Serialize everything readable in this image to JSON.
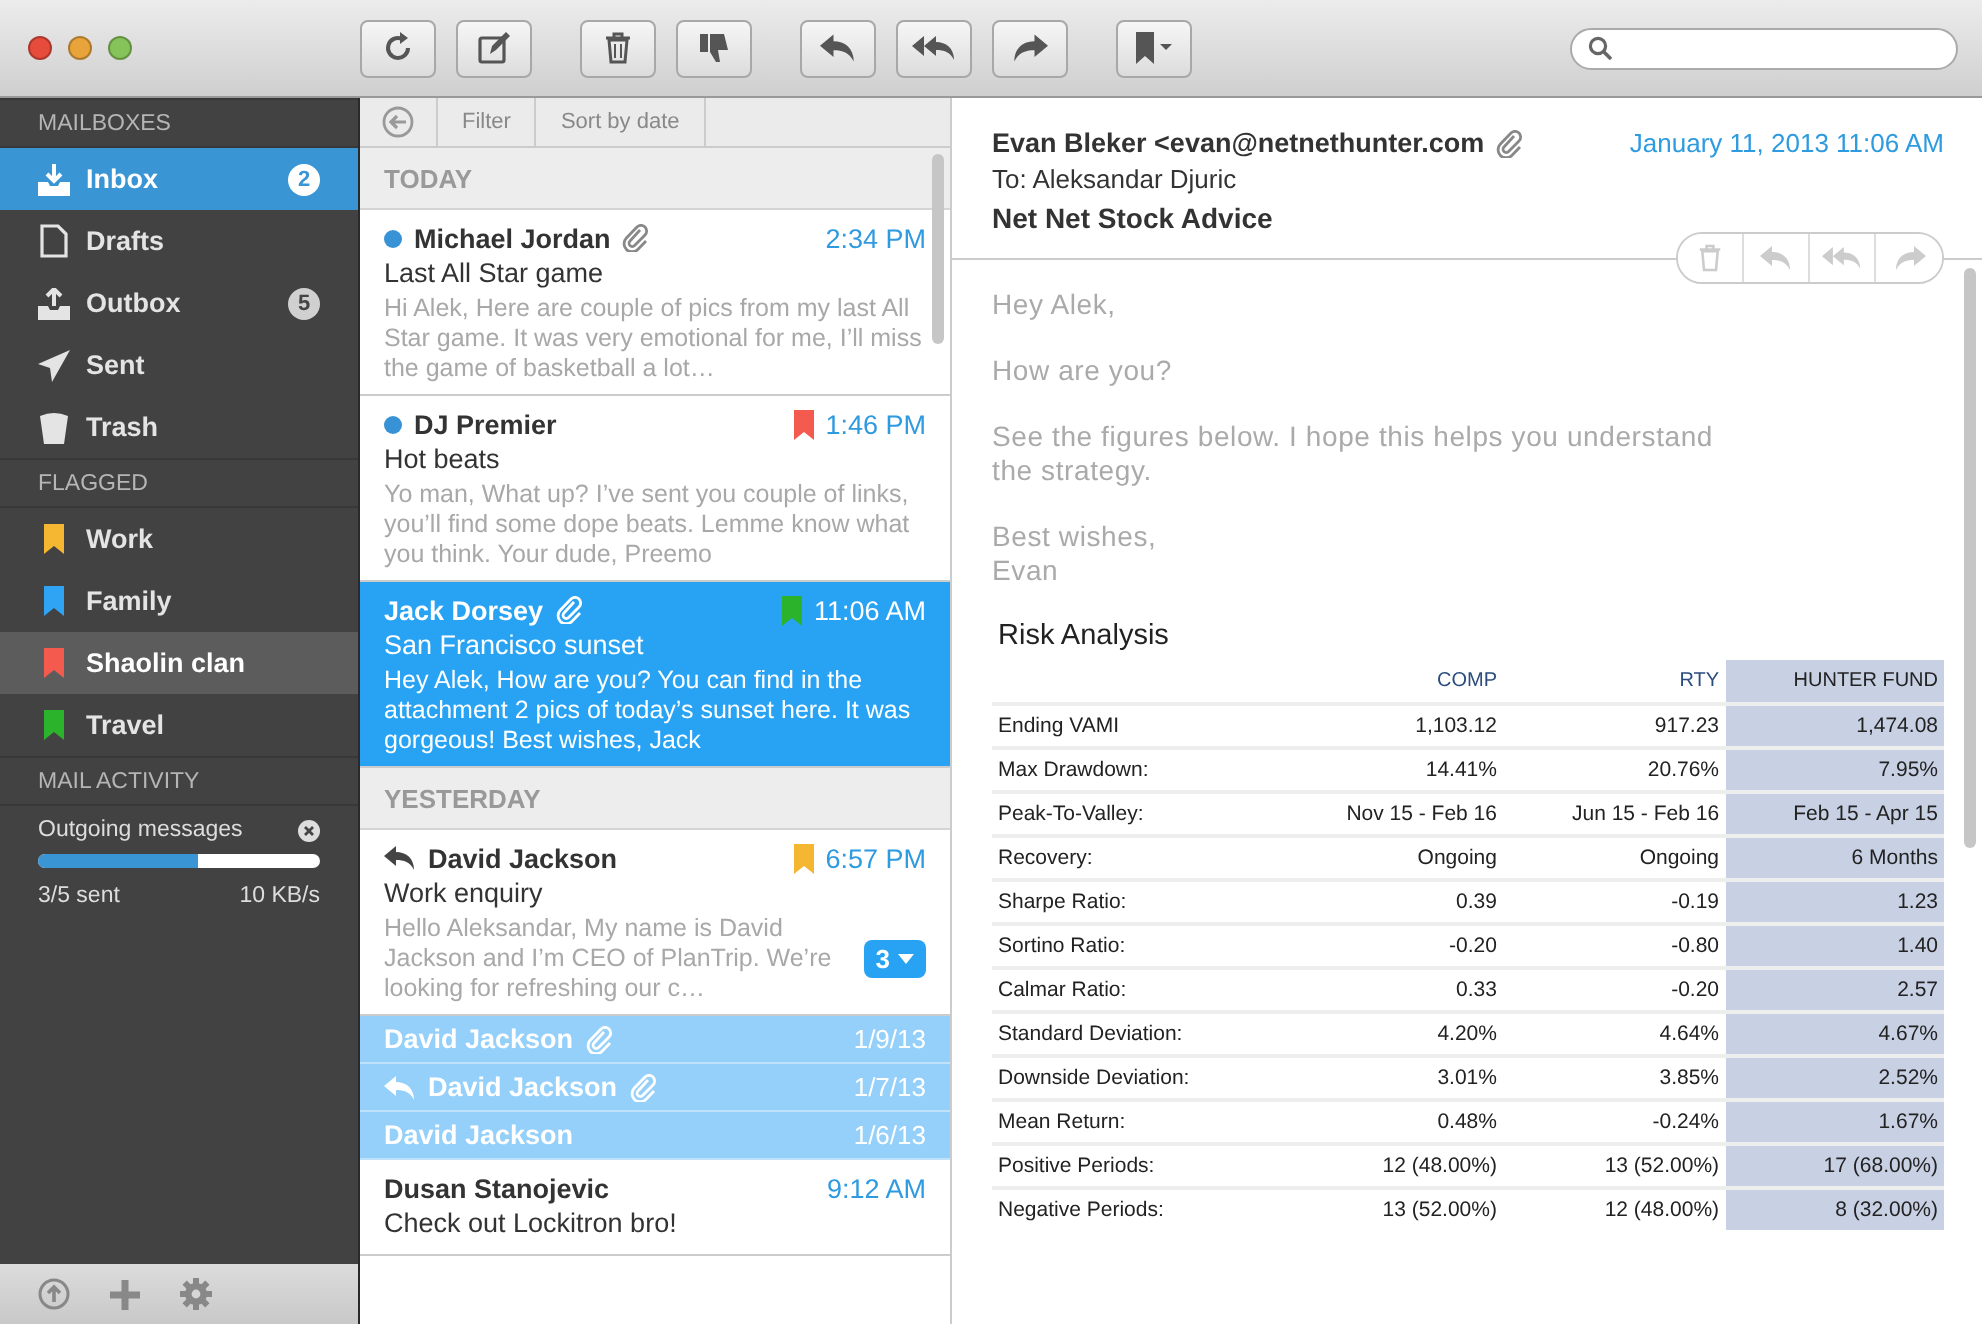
{
  "sidebar": {
    "sections": [
      {
        "title": "MAILBOXES",
        "kind": "mailboxes",
        "items": [
          {
            "label": "Inbox",
            "kind": "inbox",
            "badge": "2",
            "selected": true
          },
          {
            "label": "Drafts",
            "kind": "drafts",
            "selected": false
          },
          {
            "label": "Outbox",
            "kind": "outbox",
            "badge": "5",
            "selected": false
          },
          {
            "label": "Sent",
            "kind": "sent",
            "selected": false
          },
          {
            "label": "Trash",
            "kind": "trash",
            "selected": false
          }
        ]
      },
      {
        "title": "FLAGGED",
        "kind": "flags",
        "items": [
          {
            "label": "Work",
            "color": "#f5b731",
            "selected": false
          },
          {
            "label": "Family",
            "color": "#2fa4f5",
            "selected": false
          },
          {
            "label": "Shaolin clan",
            "color": "#f55a4e",
            "selected": true
          },
          {
            "label": "Travel",
            "color": "#2bb32b",
            "selected": false
          }
        ]
      },
      {
        "title": "MAIL ACTIVITY",
        "kind": "activity",
        "activity": {
          "label": "Outgoing messages",
          "level": 0.57,
          "count": "3/5 sent",
          "speed": "10 KB/s"
        }
      }
    ]
  },
  "message_list": {
    "filter": "Filter",
    "sort": "Sort by date",
    "groups": [
      {
        "title": "TODAY",
        "messages": [
          {
            "kind": "full",
            "sender": "Michael Jordan",
            "unread": true,
            "replied": false,
            "attachment": true,
            "time": "2:34 PM",
            "subject": "Last All Star game",
            "preview": "Hi Alek, Here are couple of pics from my last All Star game. It was very emotional for me, I’ll miss the game of basketball a lot…",
            "selected": false
          },
          {
            "kind": "full",
            "sender": "DJ Premier",
            "unread": true,
            "replied": false,
            "attachment": false,
            "color": "#f55a4e",
            "time": "1:46 PM",
            "subject": "Hot beats",
            "preview": "Yo man, What up? I’ve sent you couple of links, you’ll find some dope beats. Lemme know what you think. Your dude, Preemo",
            "selected": false
          },
          {
            "kind": "full",
            "sender": "Jack Dorsey",
            "unread": false,
            "replied": false,
            "attachment": true,
            "color": "#2bb32b",
            "time": "11:06 AM",
            "subject": "San Francisco sunset",
            "preview": "Hey Alek, How are you? You can find in the attachment 2 pics of today’s sunset here. It was gorgeous! Best wishes, Jack",
            "selected": true
          }
        ]
      },
      {
        "title": "YESTERDAY",
        "messages": [
          {
            "kind": "full",
            "sender": "David Jackson",
            "unread": false,
            "replied": true,
            "attachment": false,
            "color": "#f5b731",
            "time": "6:57 PM",
            "subject": "Work enquiry",
            "preview": "Hello Aleksandar, My name is David Jackson and I’m CEO of PlanTrip. We’re looking for refreshing our c…",
            "thread_count": "3",
            "selected": false
          },
          {
            "kind": "collapsed",
            "sender": "David Jackson",
            "replied": false,
            "attachment": true,
            "time": "1/9/13"
          },
          {
            "kind": "collapsed",
            "sender": "David Jackson",
            "replied": true,
            "attachment": true,
            "time": "1/7/13"
          },
          {
            "kind": "collapsed",
            "sender": "David Jackson",
            "replied": false,
            "attachment": false,
            "time": "1/6/13"
          },
          {
            "kind": "full",
            "sender": "Dusan Stanojevic",
            "unread": false,
            "replied": false,
            "attachment": false,
            "time": "9:12 AM",
            "subject": "Check out Lockitron bro!",
            "selected": false
          }
        ]
      }
    ]
  },
  "message": {
    "from": "Evan Bleker <evan@netnethunter.com",
    "attachment": true,
    "date": "January 11, 2013 11:06 AM",
    "to": "To: Aleksandar Djuric",
    "subject": "Net Net Stock Advice",
    "body": [
      "Hey Alek,",
      "How are you?",
      "See the figures below. I hope this helps you  understand the strategy.",
      "Best wishes,\nEvan"
    ],
    "table": {
      "title": "Risk Analysis",
      "columns": [
        {
          "highlighted": false
        },
        {
          "label": "COMP",
          "highlighted": false
        },
        {
          "label": "RTY",
          "highlighted": false
        },
        {
          "label": "HUNTER FUND",
          "highlighted": true
        }
      ],
      "rows": [
        [
          "Ending VAMI",
          "1,103.12",
          "917.23",
          "1,474.08"
        ],
        [
          "Max Drawdown:",
          "14.41%",
          "20.76%",
          "7.95%"
        ],
        [
          "Peak-To-Valley:",
          "Nov 15 - Feb 16",
          "Jun 15 - Feb 16",
          "Feb 15 - Apr 15"
        ],
        [
          "Recovery:",
          "Ongoing",
          "Ongoing",
          "6 Months"
        ],
        [
          "Sharpe Ratio:",
          "0.39",
          "-0.19",
          "1.23"
        ],
        [
          "Sortino Ratio:",
          "-0.20",
          "-0.80",
          "1.40"
        ],
        [
          "Calmar Ratio:",
          "0.33",
          "-0.20",
          "2.57"
        ],
        [
          "Standard Deviation:",
          "4.20%",
          "4.64%",
          "4.67%"
        ],
        [
          "Downside Deviation:",
          "3.01%",
          "3.85%",
          "2.52%"
        ],
        [
          "Mean Return:",
          "0.48%",
          "-0.24%",
          "1.67%"
        ],
        [
          "Positive Periods:",
          "12 (48.00%)",
          "13 (52.00%)",
          "17 (68.00%)"
        ],
        [
          "Negative Periods:",
          "13 (52.00%)",
          "12 (48.00%)",
          "8 (32.00%)"
        ]
      ]
    }
  }
}
